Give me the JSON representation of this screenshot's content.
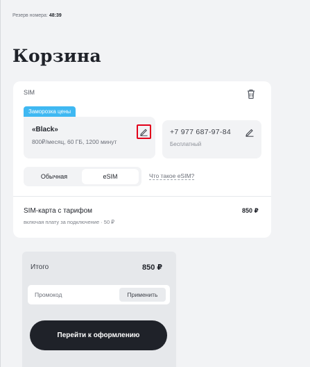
{
  "header": {
    "reserve_label": "Резерв номера:",
    "reserve_time": "48:39",
    "title": "Корзина"
  },
  "cart": {
    "section_label": "SIM",
    "badge": "Заморозка цены",
    "tariff": {
      "name": "«Black»",
      "details": "800₽/месяц, 60 ГБ, 1200 минут"
    },
    "phone": {
      "number": "+7 977 687-97-84",
      "price_note": "Бесплатный"
    },
    "sim_type": {
      "options": [
        "Обычная",
        "eSIM"
      ],
      "selected": "eSIM",
      "help_link": "Что такое eSIM?"
    },
    "line_item": {
      "title": "SIM-карта с тарифом",
      "subtitle": "включая плату за подключение · 50 ₽",
      "price": "850 ₽"
    }
  },
  "summary": {
    "total_label": "Итого",
    "total_value": "850 ₽",
    "promo_placeholder": "Промокод",
    "apply_label": "Применить",
    "checkout_label": "Перейти к оформлению"
  },
  "colors": {
    "badge": "#3fb8f2",
    "highlight": "#e2001a",
    "primary_button": "#1f2229"
  }
}
